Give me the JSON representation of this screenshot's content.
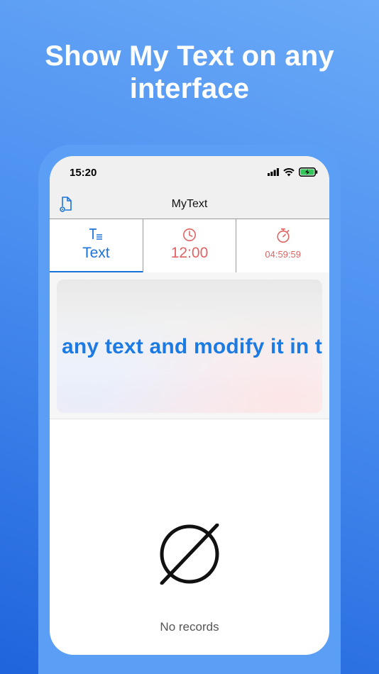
{
  "headline": {
    "line1": "Show My Text on any",
    "line2": "interface"
  },
  "status_bar": {
    "time": "15:20",
    "icons": [
      "signal-icon",
      "wifi-icon",
      "battery-charging-icon"
    ]
  },
  "nav": {
    "title": "MyText",
    "left_icon": "document-settings-icon"
  },
  "tabs": [
    {
      "label": "Text",
      "icon": "text-format-icon",
      "selected": true
    },
    {
      "label": "12:00",
      "icon": "clock-icon",
      "selected": false
    },
    {
      "label": "04:59:59",
      "icon": "stopwatch-icon",
      "selected": false
    }
  ],
  "preview": {
    "scroll_text": "any text and modify it in th"
  },
  "empty_state": {
    "icon": "empty-set-icon",
    "label": "No records"
  },
  "colors": {
    "accent_blue": "#1b73d9",
    "clock_red": "#e06464",
    "background_gradient_top": "#6aaaf7",
    "background_gradient_bottom": "#1f64dc"
  }
}
